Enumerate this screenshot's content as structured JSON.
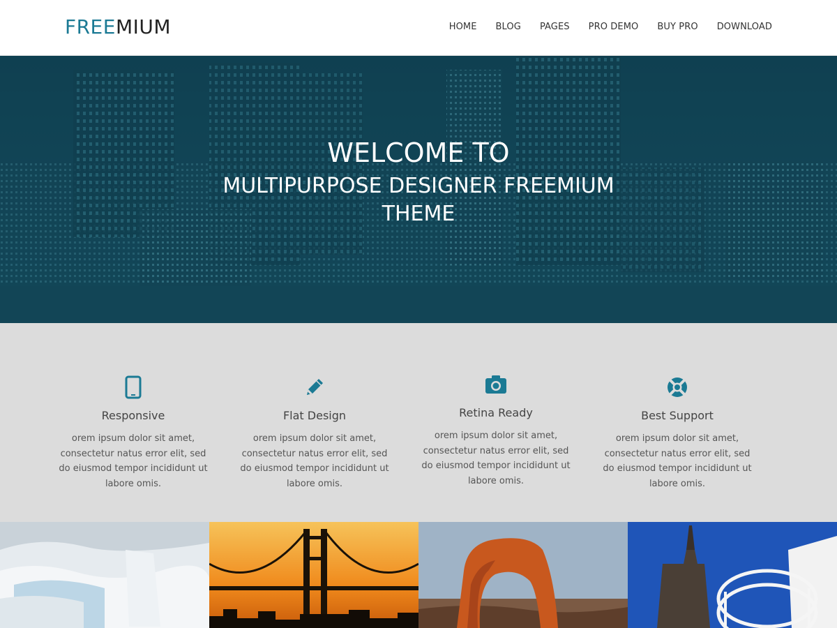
{
  "brand": {
    "part1": "FREE",
    "part2": "MIUM"
  },
  "nav": [
    "HOME",
    "BLOG",
    "PAGES",
    "PRO DEMO",
    "BUY PRO",
    "DOWNLOAD"
  ],
  "hero": {
    "title": "WELCOME TO",
    "subtitle": "MULTIPURPOSE DESIGNER FREEMIUM THEME"
  },
  "features": [
    {
      "icon": "tablet-icon",
      "title": "Responsive",
      "text": "orem ipsum dolor sit amet, consectetur natus error elit, sed do eiusmod tempor incididunt ut labore omis."
    },
    {
      "icon": "pencil-icon",
      "title": "Flat Design",
      "text": "orem ipsum dolor sit amet, consectetur natus error elit, sed do eiusmod tempor incididunt ut labore omis."
    },
    {
      "icon": "camera-icon",
      "title": "Retina Ready",
      "text": "orem ipsum dolor sit amet, consectetur natus error elit, sed do eiusmod tempor incididunt ut labore omis."
    },
    {
      "icon": "life-ring-icon",
      "title": "Best Support",
      "text": "orem ipsum dolor sit amet, consectetur natus error elit, sed do eiusmod tempor incididunt ut labore omis."
    }
  ],
  "colors": {
    "accent": "#1b7a94",
    "hero_overlay": "#124e62",
    "features_bg": "#dcdcdc"
  }
}
